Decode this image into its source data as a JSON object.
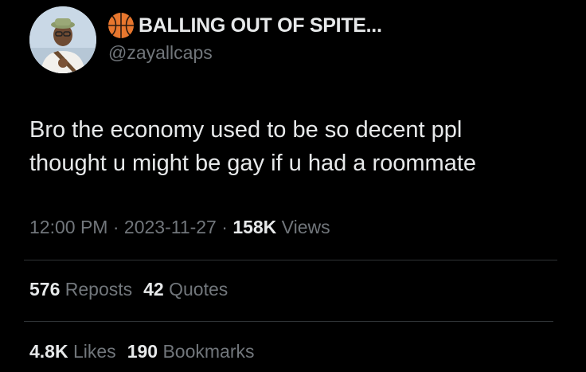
{
  "author": {
    "display_name": "BALLING OUT OF SPITE...",
    "handle": "@zayallcaps",
    "name_emoji": "basketball-icon"
  },
  "tweet": {
    "lines": [
      "Bro the economy used to be so decent ppl",
      "thought u might be gay if u had a roommate"
    ]
  },
  "meta": {
    "time": "12:00 PM",
    "sep1": " · ",
    "date": "2023-11-27",
    "sep2": " · ",
    "views_count": "158K",
    "views_label": " Views"
  },
  "stats": {
    "reposts_count": "576",
    "reposts_label": " Reposts",
    "quotes_count": "42",
    "quotes_label": " Quotes",
    "likes_count": "4.8K",
    "likes_label": " Likes",
    "bookmarks_count": "190",
    "bookmarks_label": " Bookmarks"
  },
  "colors": {
    "background": "#000000",
    "primary_text": "#e7e9ea",
    "secondary_text": "#71767b",
    "divider": "#2f3336",
    "basketball": "#e8772e"
  }
}
